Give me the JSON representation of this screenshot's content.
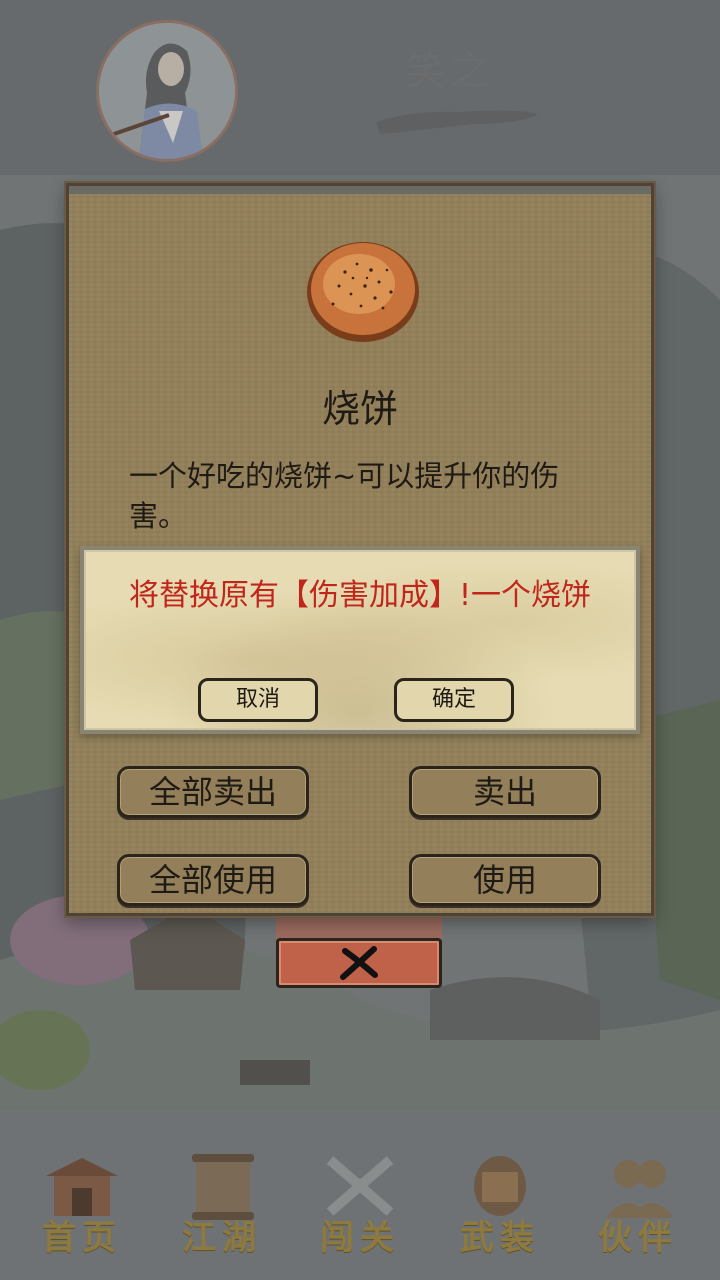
{
  "header": {
    "player_name": "笑之"
  },
  "item": {
    "name": "烧饼",
    "description": "一个好吃的烧饼~可以提升你的伤害。"
  },
  "confirm": {
    "message": "将替换原有【伤害加成】!一个烧饼",
    "cancel_label": "取消",
    "confirm_label": "确定"
  },
  "actions": {
    "sell_all_label": "全部卖出",
    "sell_label": "卖出",
    "use_all_label": "全部使用",
    "use_label": "使用"
  },
  "nav": {
    "items": [
      {
        "label": "首页",
        "icon": "home-gate-icon"
      },
      {
        "label": "江湖",
        "icon": "scroll-map-icon"
      },
      {
        "label": "闯关",
        "icon": "crossed-swords-icon"
      },
      {
        "label": "武装",
        "icon": "armor-icon"
      },
      {
        "label": "伙伴",
        "icon": "partners-icon"
      }
    ]
  },
  "colors": {
    "dialog_bg": "#93805a",
    "warning_text": "#c0261b",
    "close_button": "#c0624a",
    "nav_label": "#8e7a3e"
  }
}
